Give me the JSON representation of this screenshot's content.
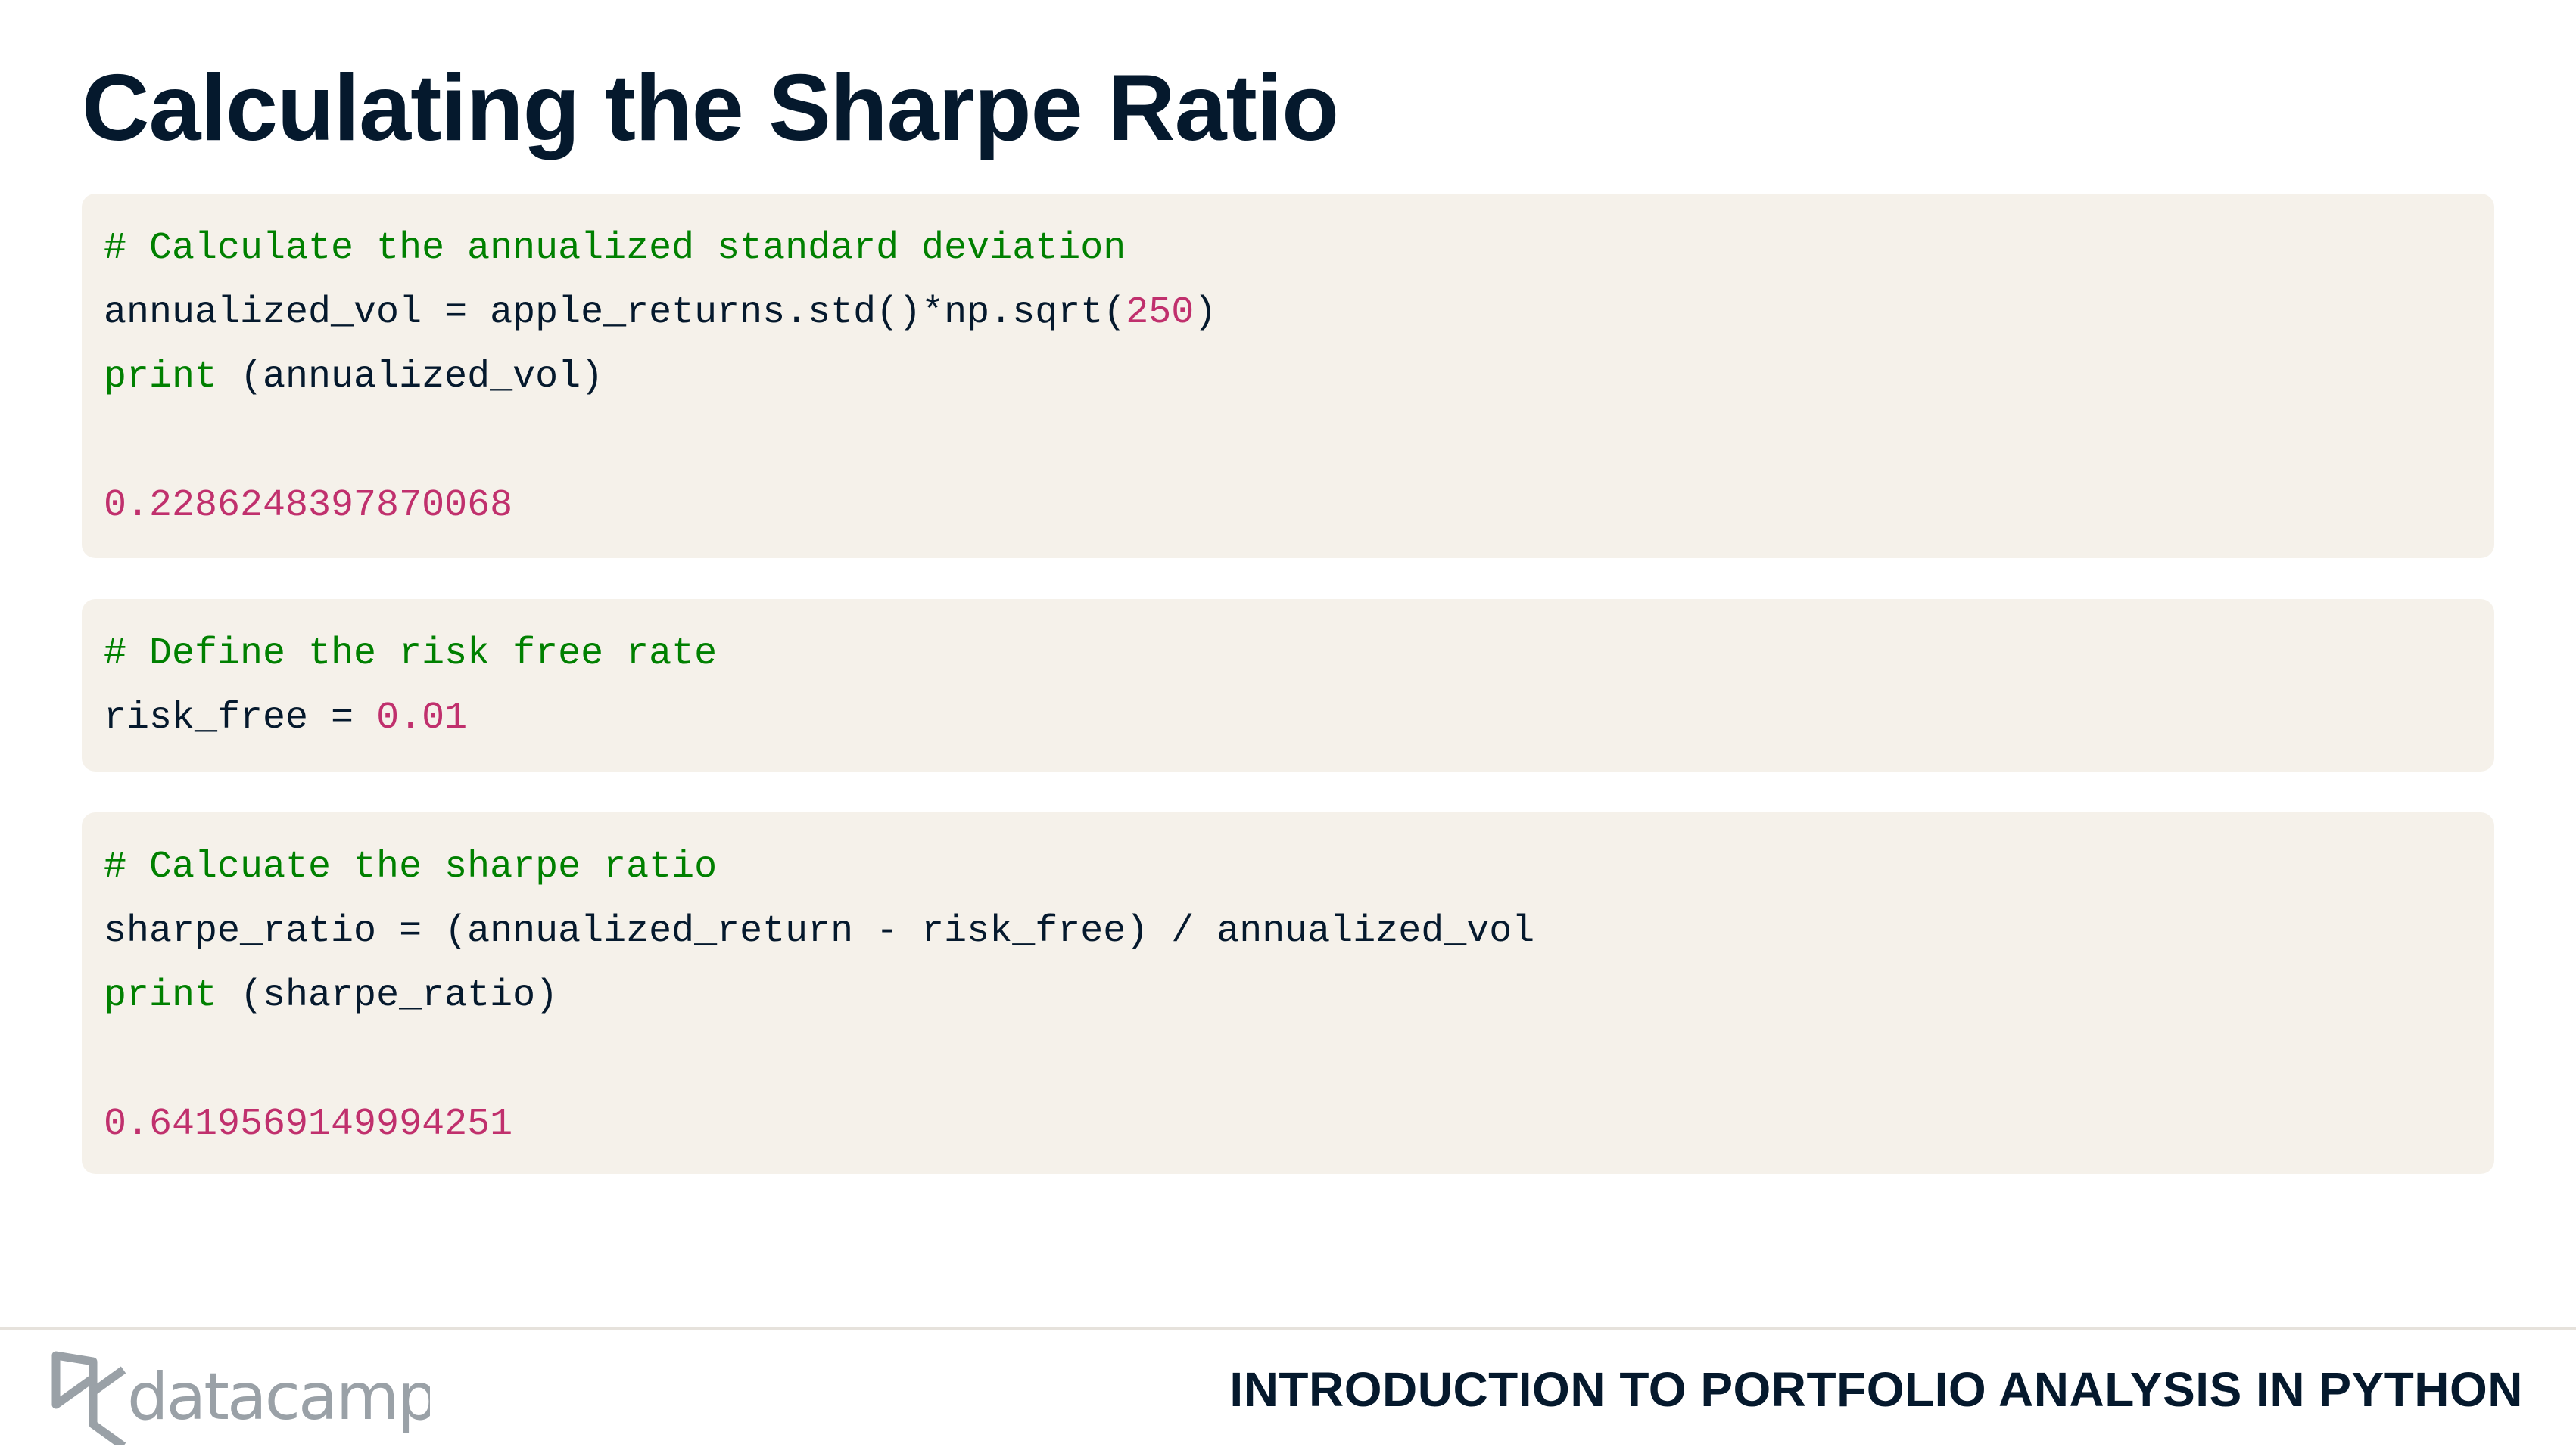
{
  "slide": {
    "title": "Calculating the Sharpe Ratio",
    "course_title": "INTRODUCTION TO PORTFOLIO ANALYSIS IN PYTHON",
    "logo_text": "datacamp"
  },
  "code_blocks": [
    {
      "lines": [
        [
          {
            "type": "c",
            "text": "# Calculate the annualized standard deviation"
          }
        ],
        [
          {
            "type": "t",
            "text": "annualized_vol = apple_returns.std()*np.sqrt("
          },
          {
            "type": "n",
            "text": "250"
          },
          {
            "type": "t",
            "text": ")"
          }
        ],
        [
          {
            "type": "k",
            "text": "print"
          },
          {
            "type": "t",
            "text": " (annualized_vol)"
          }
        ],
        [
          {
            "type": "t",
            "text": ""
          }
        ],
        [
          {
            "type": "o",
            "text": "0.2286248397870068"
          }
        ]
      ]
    },
    {
      "lines": [
        [
          {
            "type": "c",
            "text": "# Define the risk free rate"
          }
        ],
        [
          {
            "type": "t",
            "text": "risk_free = "
          },
          {
            "type": "n",
            "text": "0.01"
          }
        ]
      ]
    },
    {
      "lines": [
        [
          {
            "type": "c",
            "text": "# Calcuate the sharpe ratio"
          }
        ],
        [
          {
            "type": "t",
            "text": "sharpe_ratio = (annualized_return - risk_free) / annualized_vol"
          }
        ],
        [
          {
            "type": "k",
            "text": "print"
          },
          {
            "type": "t",
            "text": " (sharpe_ratio)"
          }
        ],
        [
          {
            "type": "t",
            "text": ""
          }
        ],
        [
          {
            "type": "o",
            "text": "0.6419569149994251"
          }
        ]
      ]
    }
  ],
  "colors": {
    "comment": "#008000",
    "keyword": "#008000",
    "number": "#c0306d",
    "text": "#05192d",
    "code_bg": "#f5f1ea",
    "logo": "#9aa1a7"
  }
}
